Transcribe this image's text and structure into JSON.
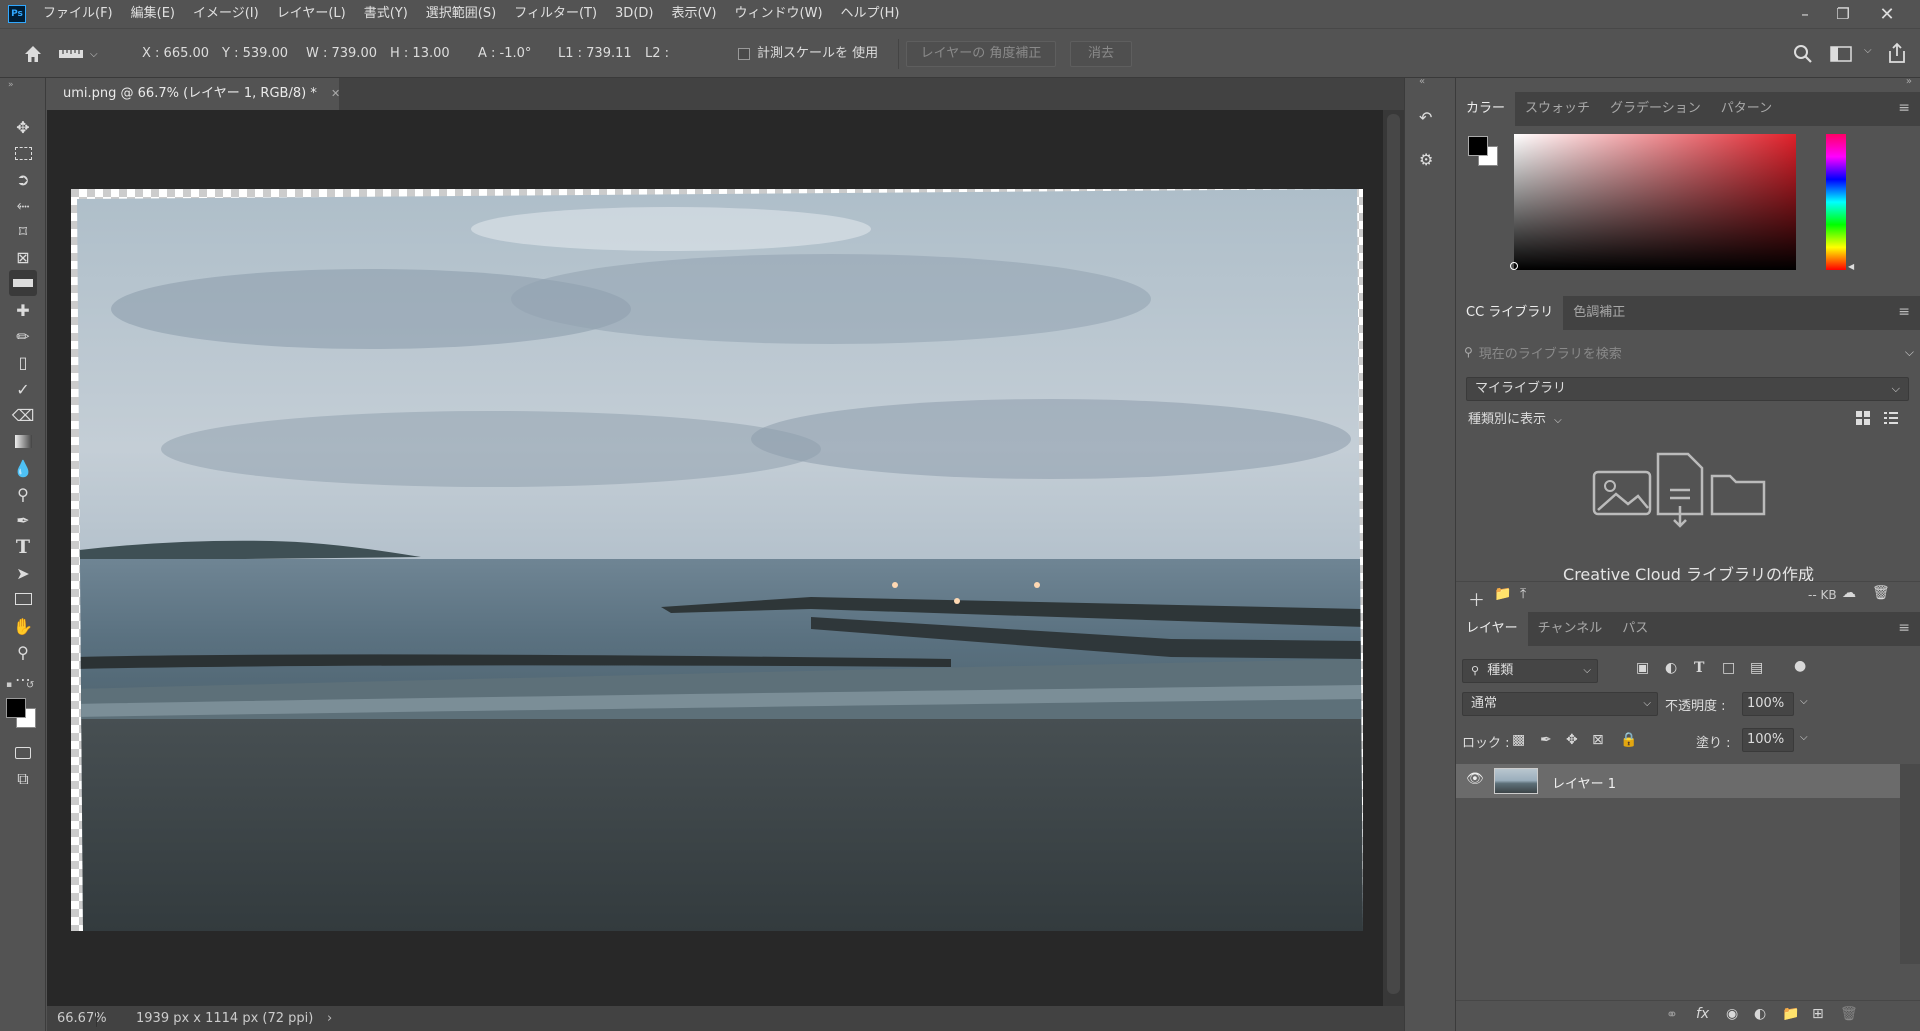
{
  "app": {
    "logo": "Ps"
  },
  "menu": [
    "ファイル(F)",
    "編集(E)",
    "イメージ(I)",
    "レイヤー(L)",
    "書式(Y)",
    "選択範囲(S)",
    "フィルター(T)",
    "3D(D)",
    "表示(V)",
    "ウィンドウ(W)",
    "ヘルプ(H)"
  ],
  "options": {
    "x": "X : 665.00",
    "y": "Y : 539.00",
    "w": "W : 739.00",
    "h": "H : 13.00",
    "a": "A : -1.0°",
    "l1": "L1 : 739.11",
    "l2": "L2 :",
    "use_scale_label": "計測スケールを 使用",
    "straighten_label": "レイヤーの 角度補正",
    "clear_label": "消去"
  },
  "document": {
    "tab_title": "umi.png @ 66.7% (レイヤー 1, RGB/8) *",
    "zoom": "66.67%",
    "doc_info": "1939 px x 1114 px (72 ppi)"
  },
  "color_panel": {
    "tabs": [
      "カラー",
      "スウォッチ",
      "グラデーション",
      "パターン"
    ],
    "foreground": "#000000",
    "background": "#ffffff",
    "hue_color": "#e0202a"
  },
  "library_panel": {
    "tabs": [
      "CC ライブラリ",
      "色調補正"
    ],
    "search_placeholder": "現在のライブラリを検索",
    "library_name": "マイライブラリ",
    "view_by": "種類別に表示",
    "create_text": "Creative Cloud ライブラリの作成",
    "storage": "-- KB"
  },
  "layers_panel": {
    "tabs": [
      "レイヤー",
      "チャンネル",
      "パス"
    ],
    "filter_kind": "種類",
    "blend_mode": "通常",
    "opacity_label": "不透明度 :",
    "opacity_value": "100%",
    "lock_label": "ロック :",
    "fill_label": "塗り :",
    "fill_value": "100%",
    "layers": [
      {
        "name": "レイヤー 1",
        "visible": true
      }
    ]
  }
}
